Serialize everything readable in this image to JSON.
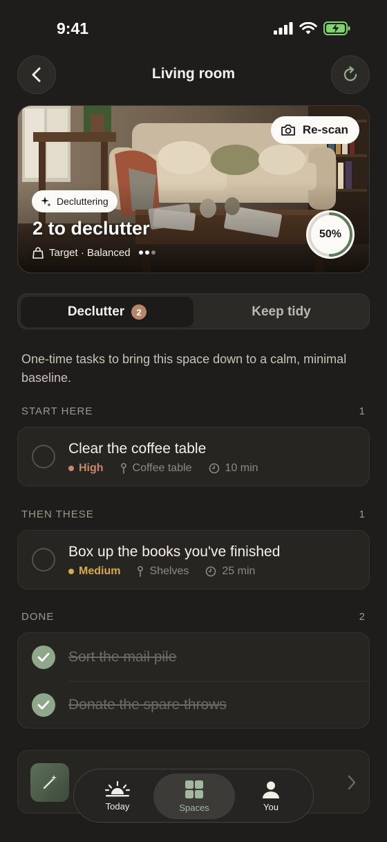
{
  "status_bar": {
    "time": "9:41"
  },
  "nav": {
    "title": "Living room"
  },
  "hero": {
    "rescan_label": "Re-scan",
    "mode_chip": "Decluttering",
    "title": "2 to declutter",
    "subtitle": "Target · Balanced",
    "progress_percent": 50,
    "progress_label": "50%"
  },
  "segmented": {
    "tabs": [
      {
        "label": "Declutter",
        "badge": "2",
        "active": true
      },
      {
        "label": "Keep tidy",
        "active": false
      }
    ]
  },
  "intro": "One-time tasks to bring this space down to a calm, minimal baseline.",
  "sections": [
    {
      "title": "START HERE",
      "count": "1",
      "tasks": [
        {
          "title": "Clear the coffee table",
          "priority": "High",
          "priority_color": "#c9876b",
          "location": "Coffee table",
          "duration": "10 min"
        }
      ]
    },
    {
      "title": "THEN THESE",
      "count": "1",
      "tasks": [
        {
          "title": "Box up the books you've finished",
          "priority": "Medium",
          "priority_color": "#d9a94c",
          "location": "Shelves",
          "duration": "25 min"
        }
      ]
    },
    {
      "title": "DONE",
      "count": "2",
      "tasks": [
        {
          "title": "Sort the mail pile"
        },
        {
          "title": "Donate the spare throws"
        }
      ]
    }
  ],
  "tabbar": {
    "items": [
      {
        "label": "Today",
        "icon": "sunrise-icon"
      },
      {
        "label": "Spaces",
        "icon": "grid-icon",
        "active": true
      },
      {
        "label": "You",
        "icon": "person-icon"
      }
    ]
  },
  "colors": {
    "accent": "#8fa88b",
    "background": "#1e1d1b",
    "card": "#262522"
  }
}
